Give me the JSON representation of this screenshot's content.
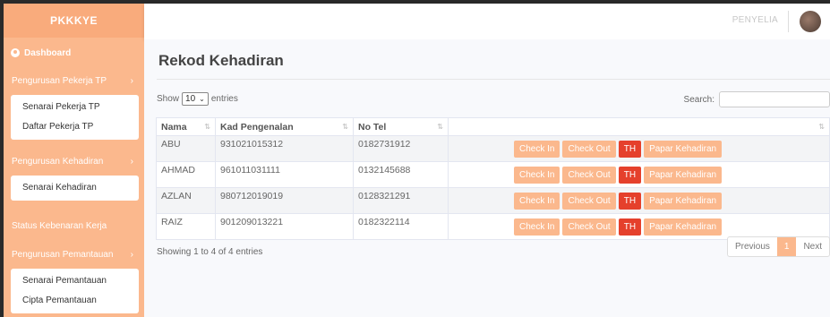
{
  "brand": "PKKKYE",
  "sidebar": {
    "dashboard": "Dashboard",
    "sections": [
      {
        "label": "Pengurusan Pekerja TP",
        "items": [
          "Senarai Pekerja TP",
          "Daftar Pekerja TP"
        ]
      },
      {
        "label": "Pengurusan Kehadiran",
        "items": [
          "Senarai Kehadiran"
        ]
      },
      {
        "label": "Status Kebenaran Kerja",
        "items": []
      },
      {
        "label": "Pengurusan Pemantauan",
        "items": [
          "Senarai Pemantauan",
          "Cipta Pemantauan"
        ]
      }
    ]
  },
  "topbar": {
    "role": "PENYELIA"
  },
  "page": {
    "title": "Rekod Kehadiran",
    "show_label": "Show",
    "entries_label": "entries",
    "page_length": "10",
    "search_label": "Search:",
    "search_value": "",
    "showing_text": "Showing 1 to 4 of 4 entries"
  },
  "table": {
    "columns": [
      "Nama",
      "Kad Pengenalan",
      "No Tel",
      ""
    ],
    "rows": [
      {
        "nama": "ABU",
        "ic": "931021015312",
        "tel": "0182731912"
      },
      {
        "nama": "AHMAD",
        "ic": "961011031111",
        "tel": "0132145688"
      },
      {
        "nama": "AZLAN",
        "ic": "980712019019",
        "tel": "0128321291"
      },
      {
        "nama": "RAIZ",
        "ic": "901209013221",
        "tel": "0182322114"
      }
    ],
    "actions": {
      "check_in": "Check In",
      "check_out": "Check Out",
      "th": "TH",
      "report": "Papar Kehadiran"
    }
  },
  "pagination": {
    "previous": "Previous",
    "current": "1",
    "next": "Next"
  },
  "colors": {
    "accent": "#fbb88d",
    "danger": "#e5402c",
    "sidebar_brand": "#f9ab7c"
  }
}
